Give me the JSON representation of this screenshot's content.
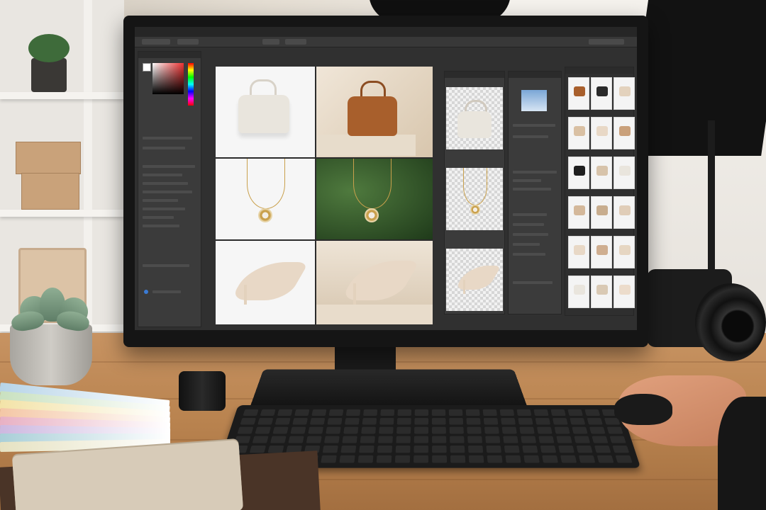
{
  "scene": {
    "description_tags": [
      "monitor-photo-editor",
      "product-photography"
    ],
    "colors": {
      "desk": "#b9834f",
      "monitor": "#151515",
      "app_bg": "#303030",
      "gold": "#c9a04c",
      "leather": "#a85f2c"
    }
  },
  "editor": {
    "menu": [
      "",
      "",
      "",
      "",
      "",
      "",
      "",
      ""
    ],
    "products": {
      "bag_white": "#e9e5dd",
      "bag_brown": "#a85f2c",
      "heel": "#e8d8c6"
    }
  }
}
